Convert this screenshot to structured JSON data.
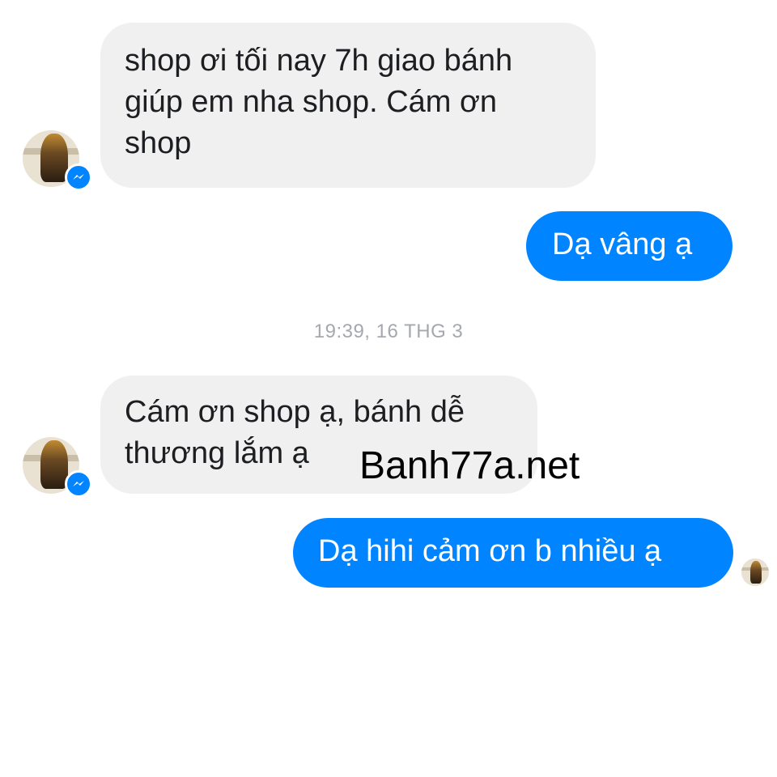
{
  "conversation": {
    "messages": [
      {
        "direction": "incoming",
        "text": "shop ơi tối nay 7h giao bánh\ngiúp em nha shop. Cám ơn\nshop"
      },
      {
        "direction": "outgoing",
        "text": "Dạ vâng ạ"
      },
      {
        "direction": "incoming",
        "text": "Cám ơn shop ạ, bánh dễ\nthương lắm ạ"
      },
      {
        "direction": "outgoing",
        "text": "Dạ hihi cảm ơn b nhiều ạ"
      }
    ],
    "timestamp": "19:39, 16 THG 3"
  },
  "watermark": "Banh77a.net",
  "icons": {
    "badge": "messenger-icon",
    "avatar": "user-avatar"
  },
  "colors": {
    "outgoing_bubble": "#0084ff",
    "incoming_bubble": "#f1f0f0",
    "timestamp": "#a5a8ad"
  }
}
